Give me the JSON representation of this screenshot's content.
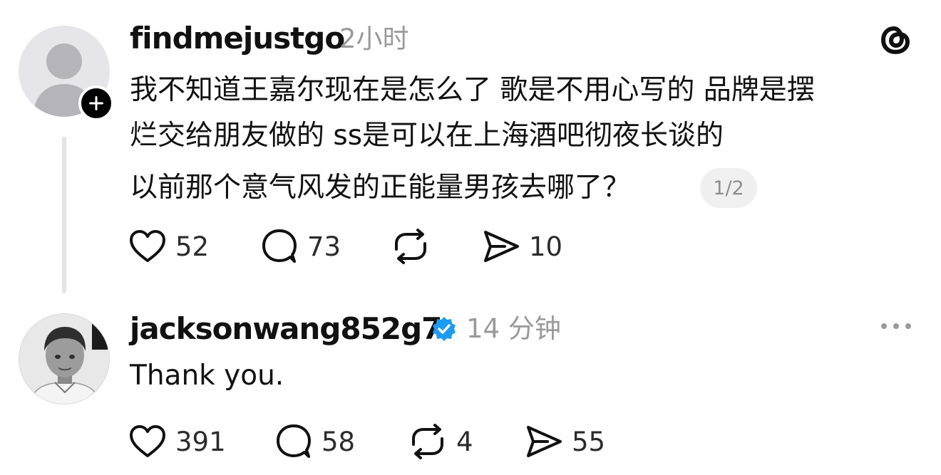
{
  "app": {
    "logo_icon": "threads-logo-icon"
  },
  "posts": [
    {
      "username": "findmejustgo",
      "time": "2小时",
      "avatar": "default-avatar",
      "lines": [
        "我不知道王嘉尔现在是怎么了 歌是不用心写的 品牌是摆",
        "烂交给朋友做的 ss是可以在上海酒吧彻夜长谈的",
        "以前那个意气风发的正能量男孩去哪了？"
      ],
      "page_indicator": "1/2",
      "stats": {
        "likes": "52",
        "replies": "73",
        "reposts": "",
        "shares": "10"
      }
    },
    {
      "username": "jacksonwang852g7",
      "verified": true,
      "time": "14 分钟",
      "avatar": "profile-photo",
      "text": "Thank you.",
      "stats": {
        "likes": "391",
        "replies": "58",
        "reposts": "4",
        "shares": "55"
      }
    }
  ],
  "colors": {
    "text": "#111111",
    "muted": "#9a9a9a",
    "verified": "#1d9bf0",
    "thread_line": "#e4e4e4"
  }
}
